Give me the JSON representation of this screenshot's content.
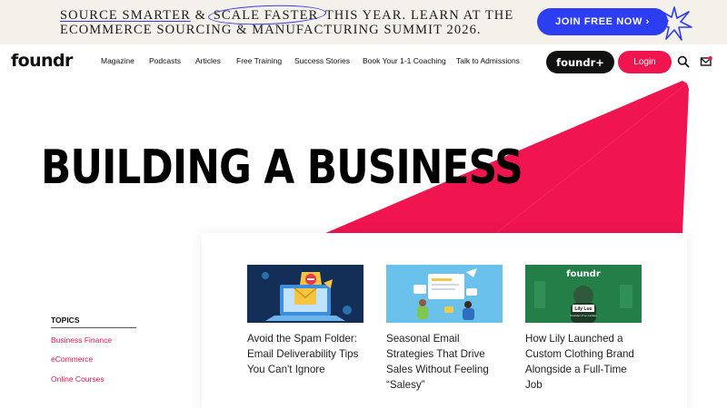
{
  "promo": {
    "line1_part1": "SOURCE SMARTER",
    "line1_amp": " & ",
    "line1_circled": "SCALE FASTER",
    "line1_part2": " THIS YEAR. LEARN AT THE",
    "line2": "ECOMMERCE SOURCING & MANUFACTURING SUMMIT 2026.",
    "button_label": "JOIN FREE NOW ›",
    "accent_color": "#2d3ef2"
  },
  "nav": {
    "logo": "foundr",
    "items": [
      "Magazine",
      "Podcasts",
      "Articles",
      "Free Training",
      "Success Stories",
      "Book Your 1-1 Coaching",
      "Talk to Admissions"
    ],
    "plus_label": "foundr+",
    "login_label": "Login",
    "icons": [
      "search-icon",
      "inbox-icon"
    ]
  },
  "hero": {
    "title": "BUILDING A BUSINESS",
    "stripe_color": "#f0144f"
  },
  "topics": {
    "heading": "TOPICS",
    "items": [
      "Business Finance",
      "eCommerce",
      "Online Courses"
    ],
    "link_color": "#e8164f"
  },
  "articles": [
    {
      "title": "Avoid the Spam Folder: Email Deliverability Tips You Can't Ignore",
      "thumbnail": "email-deliverability-illustration"
    },
    {
      "title": "Seasonal Email Strategies That Drive Sales Without Feeling “Salesy”",
      "thumbnail": "email-strategy-illustration"
    },
    {
      "title": "How Lily Launched a Custom Clothing Brand Alongside a Full-Time Job",
      "thumbnail": "founder-interview-still",
      "thumb_logo": "foundr",
      "thumb_name": "Lily Luu",
      "thumb_role": "Founder of Lu Lenses"
    }
  ]
}
